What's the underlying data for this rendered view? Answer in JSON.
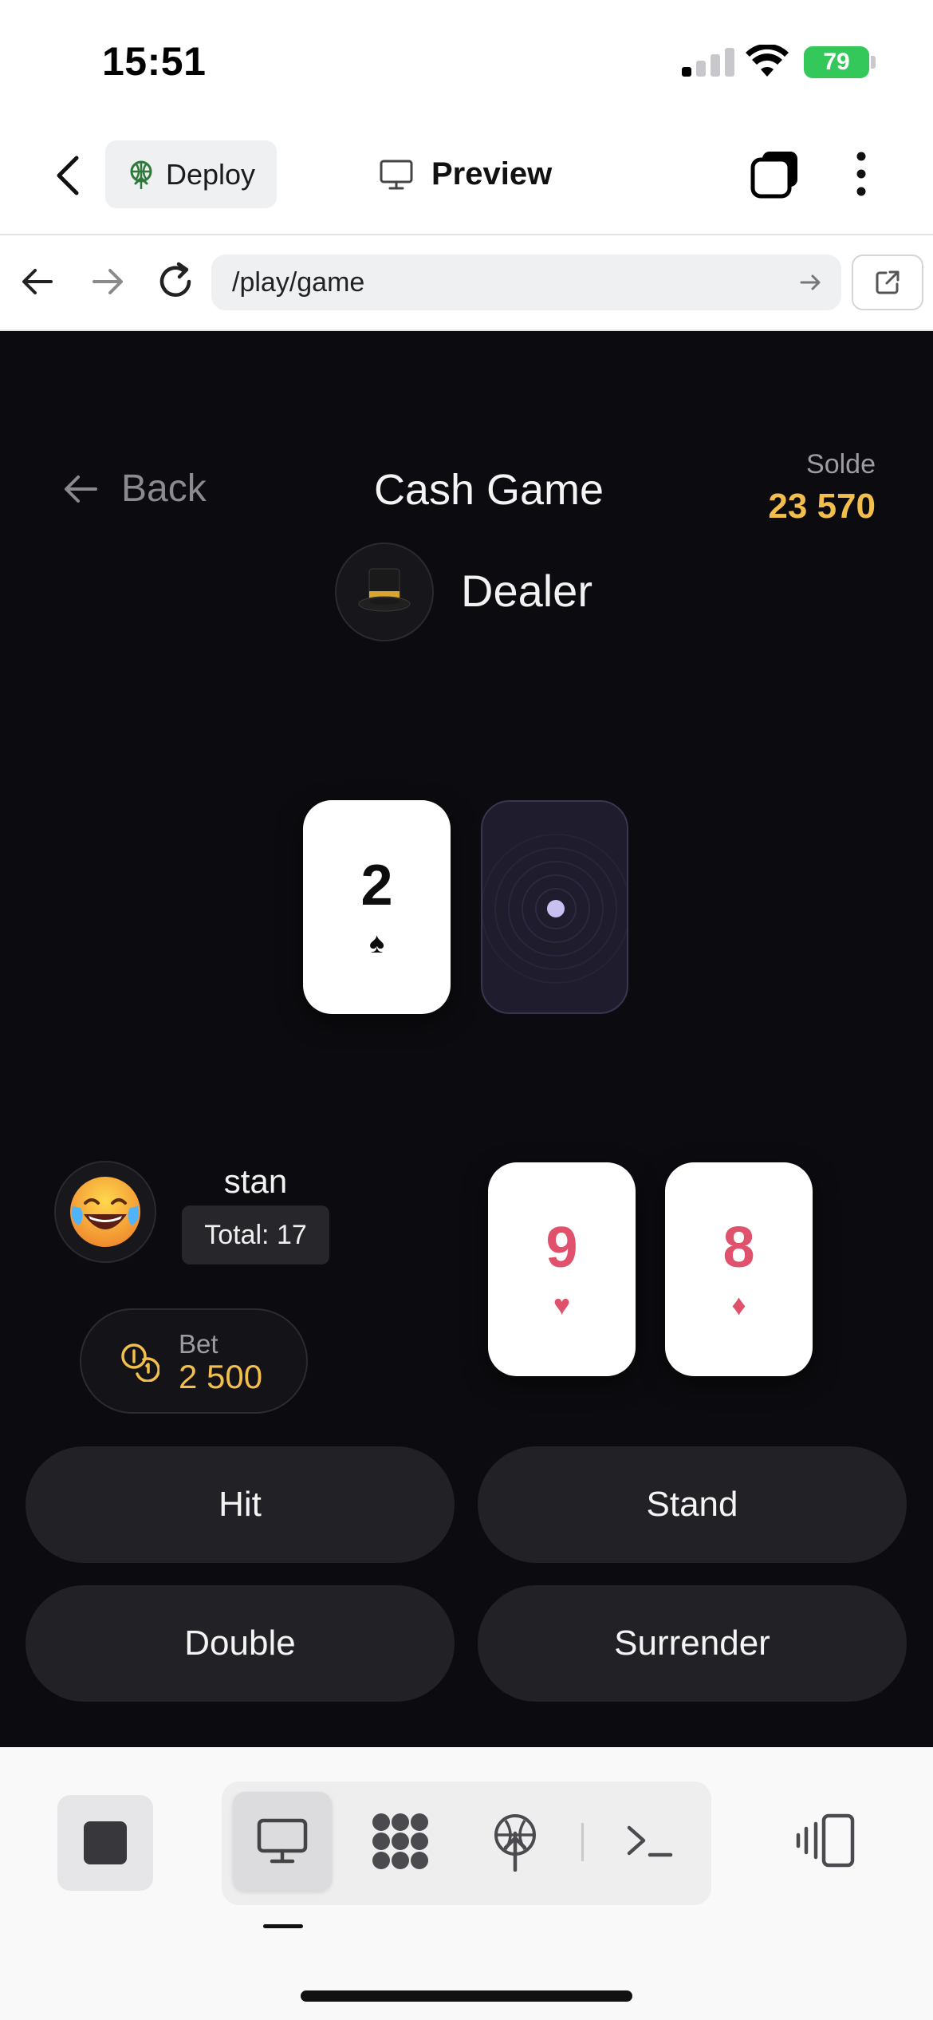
{
  "status_bar": {
    "time": "15:51",
    "battery": "79",
    "signal_bars_active": 1
  },
  "app_bar": {
    "deploy_label": "Deploy",
    "preview_label": "Preview"
  },
  "url_bar": {
    "url": "/play/game"
  },
  "game": {
    "back_label": "Back",
    "title": "Cash Game",
    "balance_label": "Solde",
    "balance_value": "23 570",
    "dealer": {
      "name": "Dealer",
      "avatar": "🎩",
      "cards": [
        {
          "rank": "2",
          "suit": "♠",
          "color": "black"
        },
        {
          "face_down": true
        }
      ]
    },
    "player": {
      "name": "stan",
      "avatar": "😂",
      "total_label": "Total: 17",
      "cards": [
        {
          "rank": "9",
          "suit": "♥",
          "color": "red"
        },
        {
          "rank": "8",
          "suit": "♦",
          "color": "red"
        }
      ]
    },
    "bet": {
      "label": "Bet",
      "value": "2 500"
    },
    "actions": {
      "hit": "Hit",
      "stand": "Stand",
      "double": "Double",
      "surrender": "Surrender"
    }
  },
  "colors": {
    "game_background": "#0c0c10",
    "gold_accent": "#f3bf4c",
    "red_suit": "#e0516b",
    "button_background": "#222226",
    "battery_green": "#34c759"
  },
  "toolbar": {
    "icons": [
      "stop-icon",
      "desktop-preview-icon",
      "pattern-grid-icon",
      "deploy-icon",
      "terminal-icon",
      "devices-icon"
    ],
    "active_mode": "desktop-preview"
  }
}
